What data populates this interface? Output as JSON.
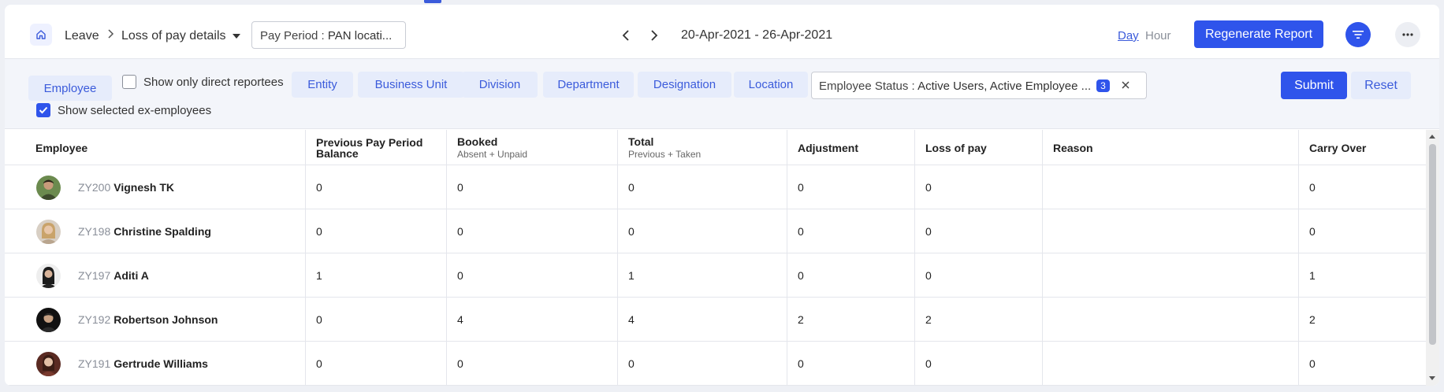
{
  "header": {
    "breadcrumb": {
      "leave": "Leave",
      "report": "Loss of pay details"
    },
    "pay_period": {
      "label": "Pay Period :",
      "value": "PAN locati..."
    },
    "date_range": "20-Apr-2021 - 26-Apr-2021",
    "view_day": "Day",
    "view_hour": "Hour",
    "regenerate_label": "Regenerate Report"
  },
  "filters": {
    "employee_label": "Employee",
    "direct_reportees_label": "Show only direct reportees",
    "direct_reportees_checked": false,
    "ex_employees_label": "Show selected ex-employees",
    "ex_employees_checked": true,
    "chips": [
      "Entity",
      "Business Unit",
      "Division",
      "Department",
      "Designation",
      "Location"
    ],
    "status": {
      "label": "Employee Status :",
      "value": "Active Users, Active Employee ...",
      "count": "3"
    },
    "submit_label": "Submit",
    "reset_label": "Reset"
  },
  "table": {
    "columns": [
      {
        "title": "Employee",
        "sub": ""
      },
      {
        "title": "Previous Pay Period Balance",
        "sub": ""
      },
      {
        "title": "Booked",
        "sub": "Absent + Unpaid"
      },
      {
        "title": "Total",
        "sub": "Previous + Taken"
      },
      {
        "title": "Adjustment",
        "sub": ""
      },
      {
        "title": "Loss of pay",
        "sub": ""
      },
      {
        "title": "Reason",
        "sub": ""
      },
      {
        "title": "Carry Over",
        "sub": ""
      }
    ],
    "rows": [
      {
        "id": "ZY200",
        "name": "Vignesh TK",
        "prev": "0",
        "booked": "0",
        "total": "0",
        "adjustment": "0",
        "lop": "0",
        "reason": "",
        "carry": "0"
      },
      {
        "id": "ZY198",
        "name": "Christine Spalding",
        "prev": "0",
        "booked": "0",
        "total": "0",
        "adjustment": "0",
        "lop": "0",
        "reason": "",
        "carry": "0"
      },
      {
        "id": "ZY197",
        "name": "Aditi A",
        "prev": "1",
        "booked": "0",
        "total": "1",
        "adjustment": "0",
        "lop": "0",
        "reason": "",
        "carry": "1"
      },
      {
        "id": "ZY192",
        "name": "Robertson Johnson",
        "prev": "0",
        "booked": "4",
        "total": "4",
        "adjustment": "2",
        "lop": "2",
        "reason": "",
        "carry": "2"
      },
      {
        "id": "ZY191",
        "name": "Gertrude Williams",
        "prev": "0",
        "booked": "0",
        "total": "0",
        "adjustment": "0",
        "lop": "0",
        "reason": "",
        "carry": "0"
      }
    ]
  },
  "colors": {
    "accent": "#2f54eb",
    "chip_bg": "#e6ecfb",
    "chip_text": "#3b5bdb"
  }
}
